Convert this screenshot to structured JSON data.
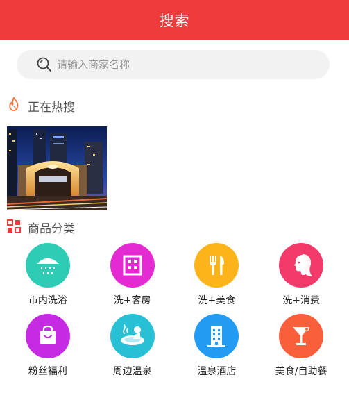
{
  "header": {
    "title": "搜索"
  },
  "search": {
    "placeholder": "请输入商家名称"
  },
  "hot": {
    "title": "正在热搜"
  },
  "category": {
    "title": "商品分类",
    "items": [
      {
        "label": "市内洗浴",
        "icon": "shower-icon",
        "color": "#2ecbb5"
      },
      {
        "label": "洗+客房",
        "icon": "building-window-icon",
        "color": "#e42bd2"
      },
      {
        "label": "洗+美食",
        "icon": "fork-knife-icon",
        "color": "#fdb41b"
      },
      {
        "label": "洗+消费",
        "icon": "woman-face-icon",
        "color": "#f43a6a"
      },
      {
        "label": "粉丝福利",
        "icon": "gift-bag-icon",
        "color": "#c42be3"
      },
      {
        "label": "周边温泉",
        "icon": "hot-spring-icon",
        "color": "#27c0d4"
      },
      {
        "label": "温泉酒店",
        "icon": "hotel-icon",
        "color": "#229cf2"
      },
      {
        "label": "美食/自助餐",
        "icon": "cocktail-icon",
        "color": "#f95f3a"
      }
    ]
  },
  "colors": {
    "header": "#ef3b3b",
    "search_bg": "#f2f2f2"
  }
}
